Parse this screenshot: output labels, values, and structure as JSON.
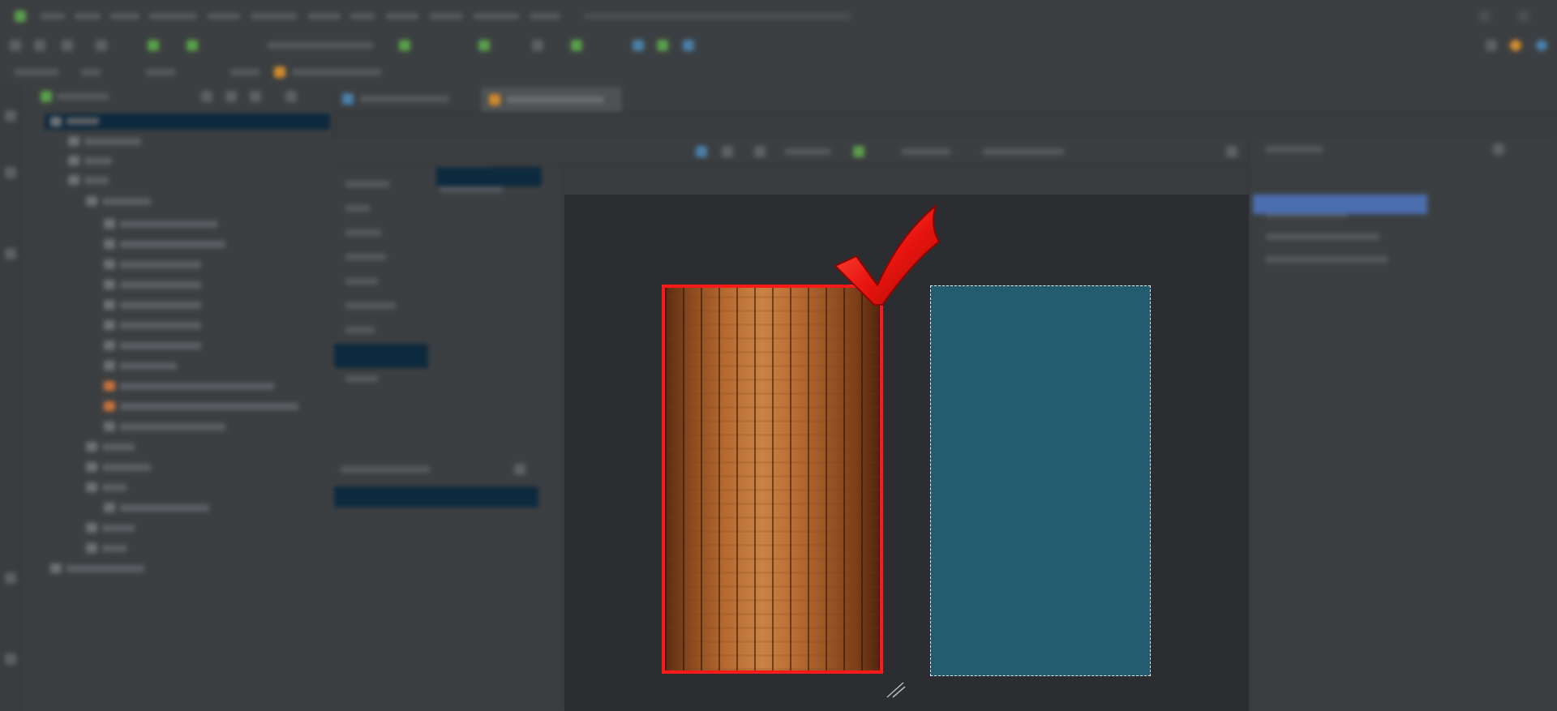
{
  "colors": {
    "ide_background": "#3a3d40",
    "canvas_background": "#2b2d30",
    "selected_outline": "#ff1a1a",
    "checkmark": "#e8140f",
    "phone_blue": "#235c6f",
    "selection_highlight": "#4b6eaf"
  },
  "icons": {
    "checkmark": "red-checkmark-icon",
    "resize": "resize-handle-icon"
  }
}
